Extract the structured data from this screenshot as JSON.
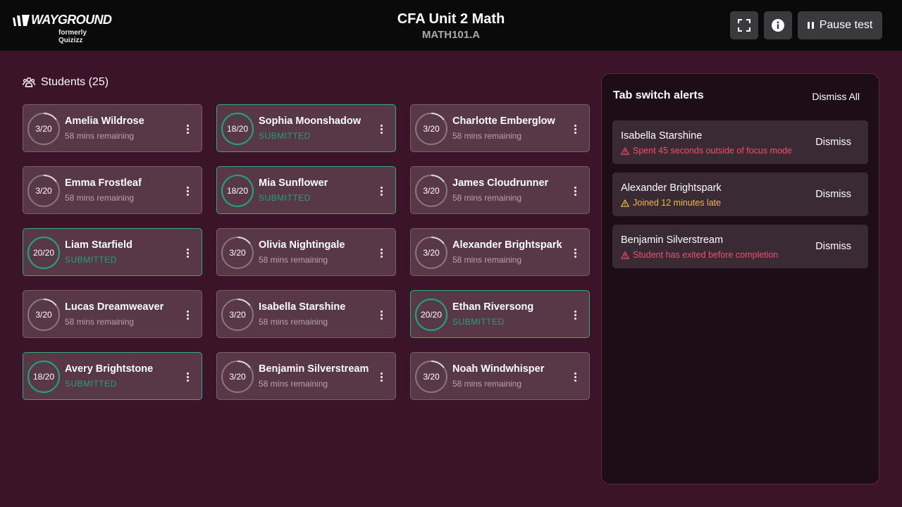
{
  "header": {
    "logo_text": "WAYGROUND",
    "logo_subtext": "formerly Quizizz",
    "title": "CFA Unit 2 Math",
    "subtitle": "MATH101.A",
    "pause_label": "Pause test",
    "icons": {
      "fullscreen": "fullscreen-icon",
      "info": "info-icon",
      "pause": "pause-icon"
    }
  },
  "students": {
    "heading": "Students (25)",
    "icon": "users-icon",
    "list": [
      {
        "name": "Amelia Wildrose",
        "score": "3/20",
        "progress": 0.15,
        "status": "58 mins remaining",
        "submitted": false
      },
      {
        "name": "Sophia Moonshadow",
        "score": "18/20",
        "progress": 0.9,
        "status": "SUBMITTED",
        "submitted": true
      },
      {
        "name": "Charlotte Emberglow",
        "score": "3/20",
        "progress": 0.15,
        "status": "58 mins remaining",
        "submitted": false
      },
      {
        "name": "Emma Frostleaf",
        "score": "3/20",
        "progress": 0.15,
        "status": "58 mins remaining",
        "submitted": false
      },
      {
        "name": "Mia Sunflower",
        "score": "18/20",
        "progress": 0.9,
        "status": "SUBMITTED",
        "submitted": true
      },
      {
        "name": "James Cloudrunner",
        "score": "3/20",
        "progress": 0.15,
        "status": "58 mins remaining",
        "submitted": false
      },
      {
        "name": "Liam Starfield",
        "score": "20/20",
        "progress": 1.0,
        "status": "SUBMITTED",
        "submitted": true
      },
      {
        "name": "Olivia Nightingale",
        "score": "3/20",
        "progress": 0.15,
        "status": "58 mins remaining",
        "submitted": false
      },
      {
        "name": "Alexander Brightspark",
        "score": "3/20",
        "progress": 0.15,
        "status": "58 mins remaining",
        "submitted": false
      },
      {
        "name": "Lucas Dreamweaver",
        "score": "3/20",
        "progress": 0.15,
        "status": "58 mins remaining",
        "submitted": false
      },
      {
        "name": "Isabella Starshine",
        "score": "3/20",
        "progress": 0.15,
        "status": "58 mins remaining",
        "submitted": false
      },
      {
        "name": "Ethan Riversong",
        "score": "20/20",
        "progress": 1.0,
        "status": "SUBMITTED",
        "submitted": true
      },
      {
        "name": "Avery Brightstone",
        "score": "18/20",
        "progress": 0.9,
        "status": "SUBMITTED",
        "submitted": true
      },
      {
        "name": "Benjamin Silverstream",
        "score": "3/20",
        "progress": 0.15,
        "status": "58 mins remaining",
        "submitted": false
      },
      {
        "name": "Noah Windwhisper",
        "score": "3/20",
        "progress": 0.15,
        "status": "58 mins remaining",
        "submitted": false
      }
    ]
  },
  "alerts": {
    "title": "Tab switch alerts",
    "dismiss_all_label": "Dismiss All",
    "dismiss_label": "Dismiss",
    "warning_icon": "warning-icon",
    "items": [
      {
        "name": "Isabella Starshine",
        "message": "Spent 45 seconds outside of focus mode",
        "color": "#f0506e"
      },
      {
        "name": "Alexander Brightspark",
        "message": "Joined 12 minutes late",
        "color": "#f2b84b"
      },
      {
        "name": "Benjamin Silverstream",
        "message": "Student has exited before completion",
        "color": "#f0506e"
      }
    ]
  },
  "colors": {
    "background": "#3c1429",
    "header": "#0b0a0b",
    "card": "#583846",
    "submitted": "#1fa37a",
    "ring_track": "#8a7580",
    "ring_progress": "#d9d9d9"
  }
}
